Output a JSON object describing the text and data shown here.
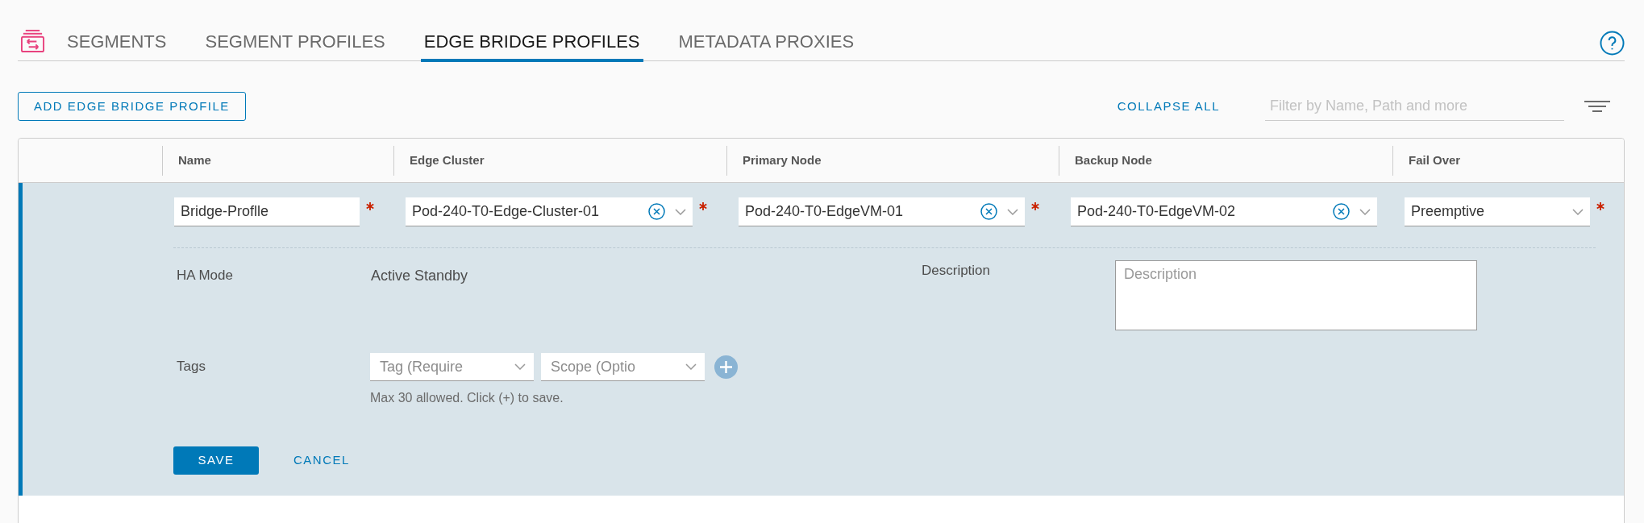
{
  "tabs": [
    {
      "label": "SEGMENTS",
      "selected": false
    },
    {
      "label": "SEGMENT PROFILES",
      "selected": false
    },
    {
      "label": "EDGE BRIDGE PROFILES",
      "selected": true
    },
    {
      "label": "METADATA PROXIES",
      "selected": false
    }
  ],
  "toolbar": {
    "add_button": "ADD EDGE BRIDGE PROFILE",
    "collapse_all": "COLLAPSE ALL",
    "filter": {
      "placeholder": "Filter by Name, Path and more"
    }
  },
  "table": {
    "columns": [
      "Name",
      "Edge Cluster",
      "Primary Node",
      "Backup Node",
      "Fail Over"
    ],
    "edit_row": {
      "fields": [
        {
          "kind": "text",
          "value": "Bridge-Proflle",
          "required": true
        },
        {
          "kind": "select",
          "value": "Pod-240-T0-Edge-Cluster-01",
          "clearable": true,
          "required": true
        },
        {
          "kind": "select",
          "value": "Pod-240-T0-EdgeVM-01",
          "clearable": true,
          "required": true
        },
        {
          "kind": "select",
          "value": "Pod-240-T0-EdgeVM-02",
          "clearable": true,
          "required": false
        },
        {
          "kind": "select",
          "value": "Preemptive",
          "clearable": false,
          "required": true
        }
      ],
      "ha_mode": {
        "label": "HA Mode",
        "value": "Active Standby"
      },
      "description": {
        "label": "Description",
        "placeholder": "Description"
      },
      "tags": {
        "label": "Tags",
        "tag": {
          "placeholder": "Tag (Require"
        },
        "scope": {
          "placeholder": "Scope (Optio"
        },
        "hint": "Max 30 allowed. Click (+) to save."
      },
      "buttons": [
        {
          "kind": "primary",
          "label": "SAVE"
        },
        {
          "kind": "link",
          "label": "CANCEL"
        }
      ]
    }
  }
}
